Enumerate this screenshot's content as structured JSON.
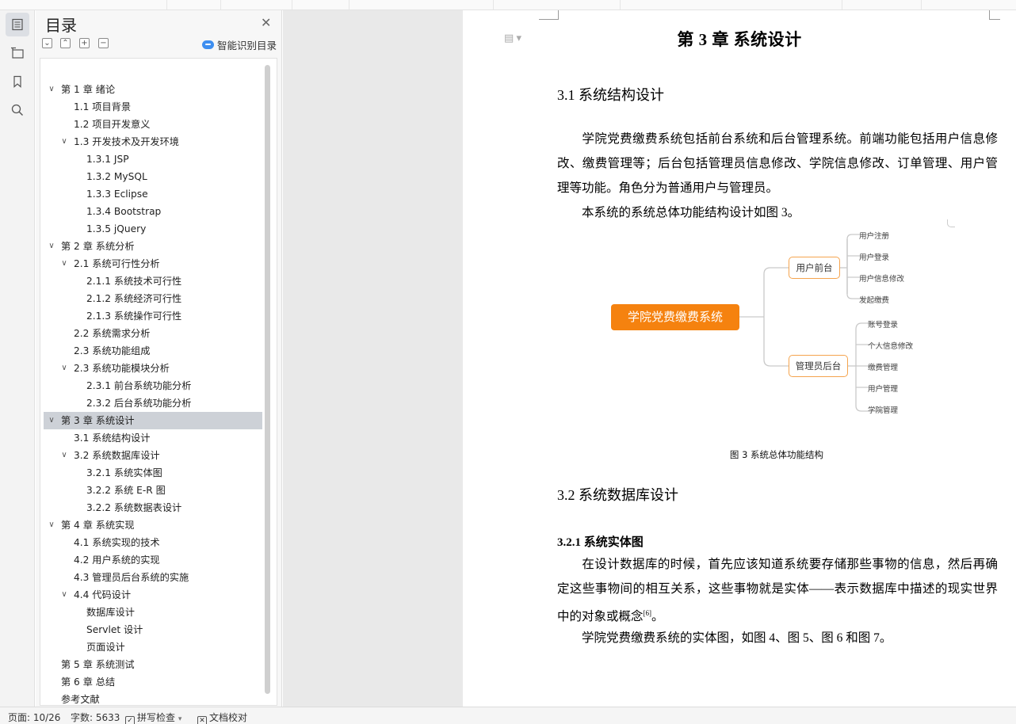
{
  "outline": {
    "title": "目录",
    "smart_label": "智能识别目录",
    "items": [
      {
        "label": "第 1 章  绪论",
        "level": 1,
        "expanded": true
      },
      {
        "label": "1.1  项目背景",
        "level": 2
      },
      {
        "label": "1.2  项目开发意义",
        "level": 2
      },
      {
        "label": "1.3  开发技术及开发环境",
        "level": 2,
        "expanded": true
      },
      {
        "label": "1.3.1 JSP",
        "level": 3
      },
      {
        "label": "1.3.2    MySQL",
        "level": 3
      },
      {
        "label": "1.3.3    Eclipse",
        "level": 3
      },
      {
        "label": "1.3.4    Bootstrap",
        "level": 3
      },
      {
        "label": "1.3.5    jQuery",
        "level": 3
      },
      {
        "label": "第 2 章  系统分析",
        "level": 1,
        "expanded": true
      },
      {
        "label": "2.1  系统可行性分析",
        "level": 2,
        "expanded": true
      },
      {
        "label": "2.1.1 系统技术可行性",
        "level": 3
      },
      {
        "label": "2.1.2 系统经济可行性",
        "level": 3
      },
      {
        "label": "2.1.3 系统操作可行性",
        "level": 3
      },
      {
        "label": "2.2 系统需求分析",
        "level": 2
      },
      {
        "label": "2.3 系统功能组成",
        "level": 2
      },
      {
        "label": "2.3    系统功能模块分析",
        "level": 2,
        "expanded": true
      },
      {
        "label": "2.3.1    前台系统功能分析",
        "level": 3
      },
      {
        "label": "2.3.2    后台系统功能分析",
        "level": 3
      },
      {
        "label": "第 3 章  系统设计",
        "level": 1,
        "expanded": true,
        "selected": true
      },
      {
        "label": "3.1  系统结构设计",
        "level": 2
      },
      {
        "label": "3.2    系统数据库设计",
        "level": 2,
        "expanded": true
      },
      {
        "label": "3.2.1 系统实体图",
        "level": 3
      },
      {
        "label": "3.2.2 系统 E-R 图",
        "level": 3
      },
      {
        "label": "3.2.2  系统数据表设计",
        "level": 3
      },
      {
        "label": "第 4 章  系统实现",
        "level": 1,
        "expanded": true
      },
      {
        "label": "4.1  系统实现的技术",
        "level": 2
      },
      {
        "label": "4.2  用户系统的实现",
        "level": 2
      },
      {
        "label": "4.3  管理员后台系统的实施",
        "level": 2
      },
      {
        "label": "4.4  代码设计",
        "level": 2,
        "expanded": true
      },
      {
        "label": "数据库设计",
        "level": 3
      },
      {
        "label": "Servlet 设计",
        "level": 3
      },
      {
        "label": "页面设计",
        "level": 3
      },
      {
        "label": "第 5 章  系统测试",
        "level": 1
      },
      {
        "label": "第 6 章  总结",
        "level": 1
      },
      {
        "label": "参考文献",
        "level": 1
      }
    ]
  },
  "document": {
    "chapter_title": "第 3 章  系统设计",
    "s31_title": "3.1  系统结构设计",
    "p1": "学院党费缴费系统包括前台系统和后台管理系统。前端功能包括用户信息修改、缴费管理等；后台包括管理员信息修改、学院信息修改、订单管理、用户管理等功能。角色分为普通用户与管理员。",
    "p2": "本系统的系统总体功能结构设计如图 3。",
    "figure": {
      "root": "学院党费缴费系统",
      "branch1": "用户前台",
      "branch1_leaves": [
        "用户注册",
        "用户登录",
        "用户信息修改",
        "发起缴费"
      ],
      "branch2": "管理员后台",
      "branch2_leaves": [
        "账号登录",
        "个人信息修改",
        "缴费管理",
        "用户管理",
        "学院管理"
      ],
      "caption": "图 3 系统总体功能结构"
    },
    "s32_title": "3.2    系统数据库设计",
    "s321_title": "3.2.1 系统实体图",
    "p3": "在设计数据库的时候，首先应该知道系统要存储那些事物的信息，然后再确定这些事物间的相互关系，这些事物就是实体——表示数据库中描述的现实世界中的对象或概念",
    "p3_ref": "[6]",
    "p3_end": "。",
    "p4": "学院党费缴费系统的实体图，如图 4、图 5、图 6 和图 7。"
  },
  "status": {
    "page": "页面: 10/26",
    "words": "字数: 5633",
    "spell": "拼写检查",
    "proof": "文档校对"
  },
  "colors": {
    "accent_orange": "#f5820f",
    "selected_bg": "#cdd1d7",
    "smart_icon": "#3d8ef0"
  }
}
